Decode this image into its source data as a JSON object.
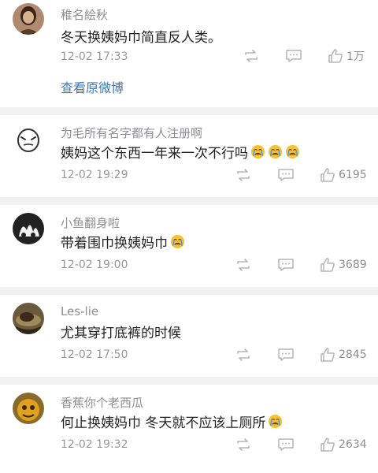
{
  "comments": [
    {
      "username": "稚名絵秋",
      "text": "冬天换姨妈巾简直反人类。",
      "time": "12-02 17:33",
      "likes": "1万",
      "crying_emoji_count": 0,
      "link": "查看原微博"
    },
    {
      "username": "为毛所有名字都有人注册啊",
      "text": "姨妈这个东西一年来一次不行吗",
      "time": "12-02 19:29",
      "likes": "6195",
      "crying_emoji_count": 3
    },
    {
      "username": "小鱼翻身啦",
      "text": "带着围巾换姨妈巾",
      "time": "12-02 19:00",
      "likes": "3689",
      "crying_emoji_count": 1
    },
    {
      "username": "Les-lie",
      "text": "尤其穿打底裤的时候",
      "time": "12-02 17:50",
      "likes": "2845",
      "crying_emoji_count": 0
    },
    {
      "username": "香蕉你个老西瓜",
      "text": "何止换姨妈巾 冬天就不应该上厕所",
      "time": "12-02 19:32",
      "likes": "2634",
      "crying_emoji_count": 1
    }
  ],
  "colors": {
    "username": "#8e8e93",
    "text": "#222222",
    "meta": "#9a9a9a",
    "link": "#3d79b8",
    "separator": "#f2f2f2"
  },
  "icons": [
    "repost-icon",
    "comment-icon",
    "like-icon",
    "crying-emoji-icon"
  ]
}
